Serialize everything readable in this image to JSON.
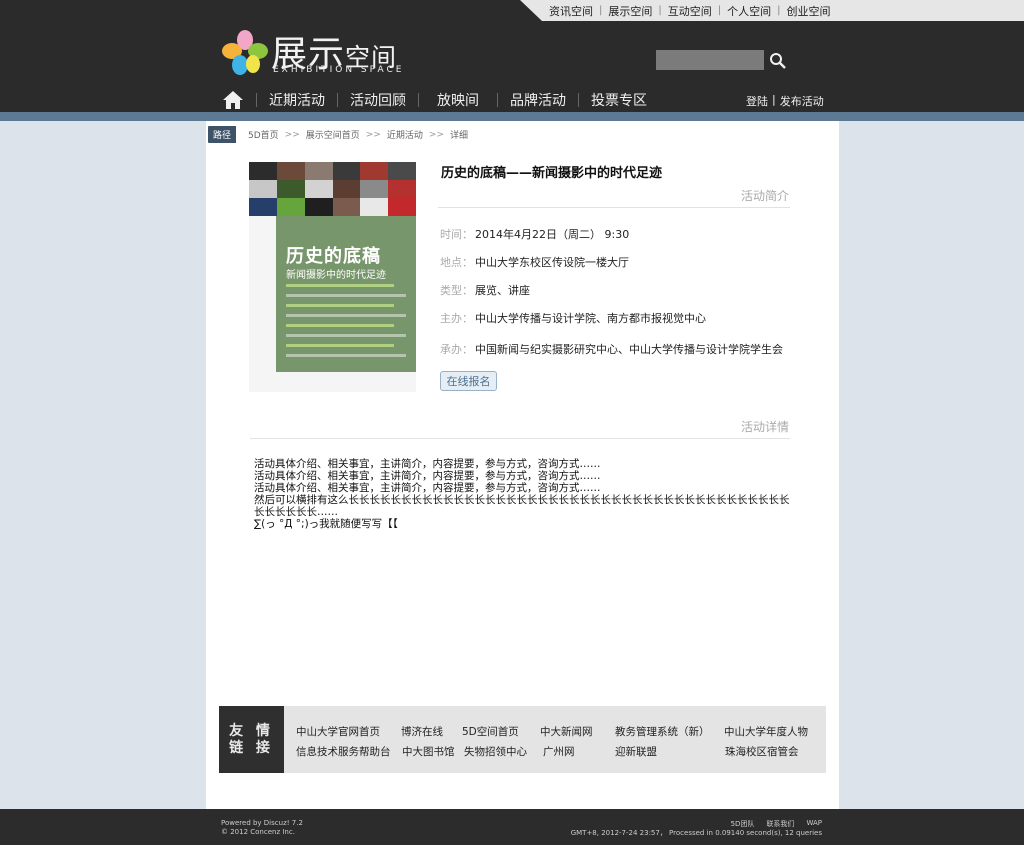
{
  "topnav": [
    "资讯空间",
    "展示空间",
    "互动空间",
    "个人空间",
    "创业空间"
  ],
  "logo": {
    "title_big": "展示",
    "title_small": "空间",
    "subtitle": "EXHIBITION SPACE"
  },
  "search": {
    "placeholder": ""
  },
  "mainnav": [
    "近期活动",
    "活动回顾",
    "放映间",
    "品牌活动",
    "投票专区"
  ],
  "auth": {
    "login": "登陆",
    "sep": "|",
    "publish": "发布活动"
  },
  "breadcrumb": {
    "tag": "路径",
    "items": [
      "5D首页",
      "展示空间首页",
      "近期活动",
      "详细"
    ],
    "sep": ">>"
  },
  "poster": {
    "title": "历史的底稿",
    "subtitle": "新闻摄影中的时代足迹"
  },
  "event": {
    "title": "历史的底稿——新闻摄影中的时代足迹",
    "intro_heading": "活动简介",
    "detail_heading": "活动详情",
    "signup": "在线报名",
    "fields": [
      {
        "k": "时间：",
        "v": "2014年4月22日（周二） 9:30"
      },
      {
        "k": "地点：",
        "v": "中山大学东校区传设院一楼大厅"
      },
      {
        "k": "类型：",
        "v": "展览、讲座"
      },
      {
        "k": "主办：",
        "v": "中山大学传播与设计学院、南方都市报视觉中心"
      },
      {
        "k": "承办：",
        "v": "中国新闻与纪实摄影研究中心、中山大学传播与设计学院学生会"
      }
    ],
    "detail_lines": [
      "活动具体介绍、相关事宜，主讲简介，内容提要，参与方式，咨询方式……",
      "活动具体介绍、相关事宜，主讲简介，内容提要，参与方式，咨询方式……",
      "活动具体介绍、相关事宜，主讲简介，内容提要，参与方式，咨询方式……",
      "然后可以横排有这么长长长长长长长长长长长长长长长长长长长长长长长长长长长长长长长长长长长长长长长长长长长长长长长长……",
      "∑(っ °Д °;)っ我就随便写写【【"
    ]
  },
  "friend_links": {
    "label_1": "友 情",
    "label_2": "链 接",
    "row1": [
      "中山大学官网首页",
      "博济在线",
      "5D空间首页",
      "中大新闻网",
      "教务管理系统（新）",
      "中山大学年度人物"
    ],
    "row2": [
      "信息技术服务帮助台",
      "中大图书馆",
      "失物招领中心",
      "广州网",
      "迎新联盟",
      "珠海校区宿管会"
    ]
  },
  "footer": {
    "powered": "Powered by Discuz! 7.2",
    "copyright": "© 2012 Concenz Inc.",
    "links": [
      "5D团队",
      "联系我们",
      "WAP"
    ],
    "stats": "GMT+8, 2012-7-24 23:57， Processed in 0.09140 second(s), 12 queries"
  }
}
